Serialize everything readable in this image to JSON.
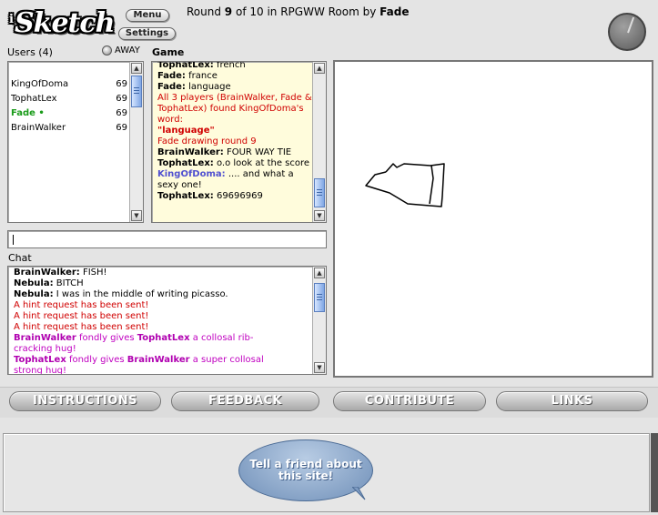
{
  "app": {
    "logo": "Sketch",
    "logo_prefix": "i"
  },
  "toolbar": {
    "menu_label": "Menu",
    "settings_label": "Settings"
  },
  "round": {
    "prefix": "Round",
    "number": "9",
    "of_text": "of 10 in RPGWW Room by",
    "host": "Fade"
  },
  "users": {
    "header": "Users (4)",
    "away_label": "AWAY",
    "list": [
      {
        "name": "KingOfDoma",
        "score": "69"
      },
      {
        "name": "TophatLex",
        "score": "69"
      },
      {
        "name": "Fade •",
        "score": "69"
      },
      {
        "name": "BrainWalker",
        "score": "69"
      }
    ]
  },
  "game": {
    "header": "Game",
    "messages": [
      {
        "who": "TophatLex:",
        "text": " french"
      },
      {
        "who": "Fade:",
        "text": " france"
      },
      {
        "who": "Fade:",
        "text": " language"
      },
      {
        "sys": "All 3 players (BrainWalker, Fade & TophatLex) found KingOfDoma's word:"
      },
      {
        "sys_bold": "\"language\""
      },
      {
        "sys": "Fade drawing round 9"
      },
      {
        "who": "BrainWalker:",
        "text": " FOUR WAY TIE"
      },
      {
        "who": "TophatLex:",
        "text": " o.o look at the score"
      },
      {
        "who": "KingOfDoma:",
        "text": " .... and what a sexy one!"
      },
      {
        "who": "TophatLex:",
        "text": " 69696969"
      }
    ]
  },
  "chat": {
    "header": "Chat",
    "input_value": "",
    "messages": [
      {
        "who": "BrainWalker:",
        "text": " FISH!"
      },
      {
        "who": "Nebula:",
        "text": " BITCH"
      },
      {
        "who": "Nebula:",
        "text": " I was in the middle of writing picasso."
      },
      {
        "sys": "A hint request has been sent!"
      },
      {
        "sys": "A hint request has been sent!"
      },
      {
        "sys": "A hint request has been sent!"
      },
      {
        "hug_from": "BrainWalker",
        "hug_mid": " fondly gives ",
        "hug_to": "TophatLex",
        "hug_end": " a collosal rib-cracking hug!"
      },
      {
        "hug_from": "TophatLex",
        "hug_mid": " fondly gives ",
        "hug_to": "BrainWalker",
        "hug_end": " a super collosal strong hug!"
      }
    ]
  },
  "nav": {
    "instructions": "INSTRUCTIONS",
    "feedback": "FEEDBACK",
    "contribute": "CONTRIBUTE",
    "links": "LINKS"
  },
  "promo": {
    "bubble_text": "Tell a friend about this site!"
  },
  "colors": {
    "system_message": "#d00000",
    "hug_message": "#c000c0",
    "active_user": "#1a9b1a",
    "game_bg": "#fffcdc"
  }
}
